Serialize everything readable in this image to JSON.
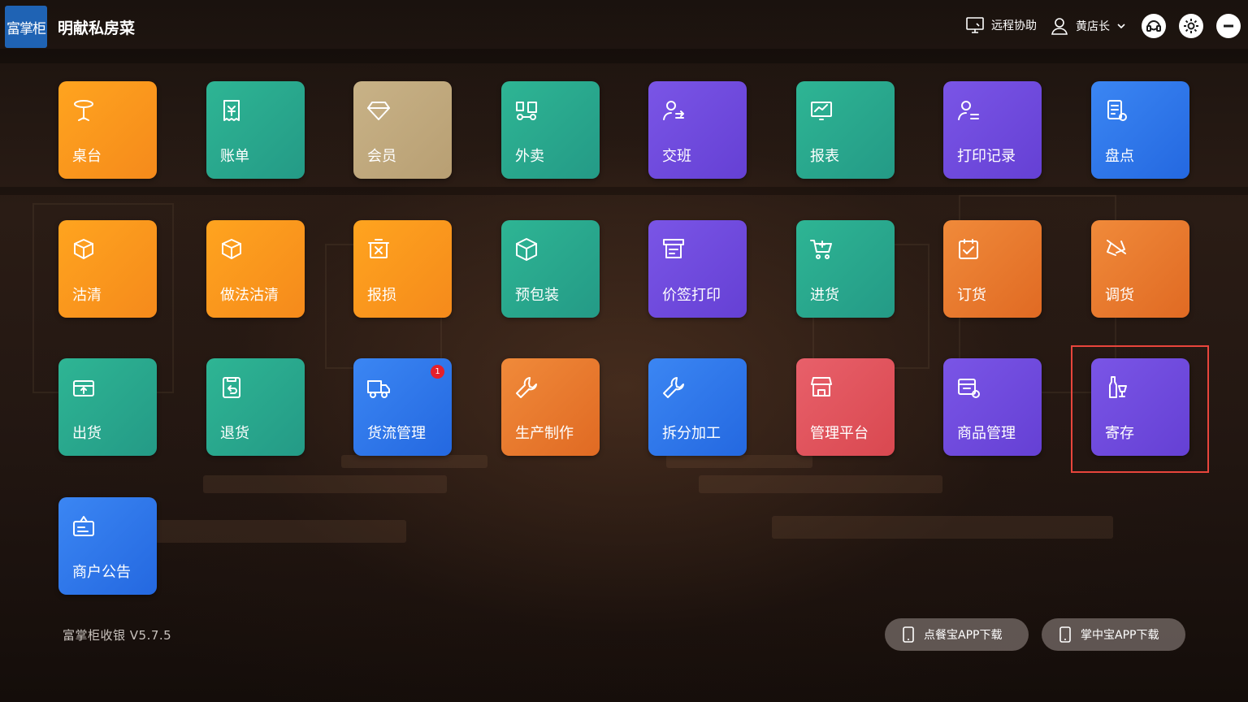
{
  "header": {
    "logo_text": "富掌柜",
    "shop_name": "明献私房菜",
    "remote_assist": "远程协助",
    "user_name": "黄店长"
  },
  "tiles": [
    {
      "label": "桌台",
      "icon": "table-icon",
      "color": "orange"
    },
    {
      "label": "账单",
      "icon": "bill-icon",
      "color": "teal"
    },
    {
      "label": "会员",
      "icon": "diamond-icon",
      "color": "tan"
    },
    {
      "label": "外卖",
      "icon": "delivery-icon",
      "color": "teal"
    },
    {
      "label": "交班",
      "icon": "shift-icon",
      "color": "purple"
    },
    {
      "label": "报表",
      "icon": "report-icon",
      "color": "teal"
    },
    {
      "label": "打印记录",
      "icon": "print-record-icon",
      "color": "purple"
    },
    {
      "label": "盘点",
      "icon": "inventory-icon",
      "color": "blue"
    },
    {
      "label": "沽清",
      "icon": "box-icon",
      "color": "orange"
    },
    {
      "label": "做法沽清",
      "icon": "box-icon",
      "color": "orange"
    },
    {
      "label": "报损",
      "icon": "damage-icon",
      "color": "orange"
    },
    {
      "label": "预包装",
      "icon": "package-icon",
      "color": "teal"
    },
    {
      "label": "价签打印",
      "icon": "price-tag-icon",
      "color": "purple"
    },
    {
      "label": "进货",
      "icon": "cart-icon",
      "color": "teal"
    },
    {
      "label": "订货",
      "icon": "order-check-icon",
      "color": "orange2"
    },
    {
      "label": "调货",
      "icon": "transfer-icon",
      "color": "orange2"
    },
    {
      "label": "出货",
      "icon": "ship-out-icon",
      "color": "teal"
    },
    {
      "label": "退货",
      "icon": "return-icon",
      "color": "teal"
    },
    {
      "label": "货流管理",
      "icon": "truck-icon",
      "color": "blue",
      "badge": "1"
    },
    {
      "label": "生产制作",
      "icon": "wrench-icon",
      "color": "orange2"
    },
    {
      "label": "拆分加工",
      "icon": "wrench-icon",
      "color": "blue"
    },
    {
      "label": "管理平台",
      "icon": "store-icon",
      "color": "red"
    },
    {
      "label": "商品管理",
      "icon": "goods-icon",
      "color": "purple"
    },
    {
      "label": "寄存",
      "icon": "bottle-icon",
      "color": "purple"
    },
    {
      "label": "商户公告",
      "icon": "notice-icon",
      "color": "blue"
    }
  ],
  "footer": {
    "version": "富掌柜收银 V5.7.5",
    "download_order_app": "点餐宝APP下载",
    "download_manager_app": "掌中宝APP下载"
  }
}
